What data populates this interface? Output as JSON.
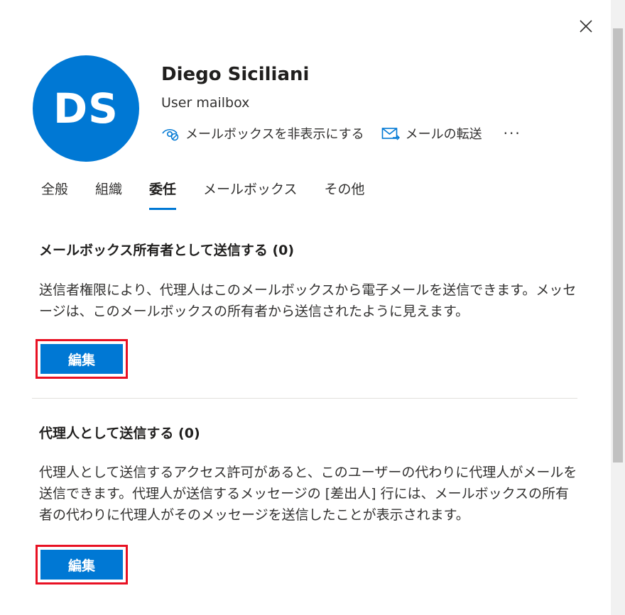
{
  "user": {
    "initials": "DS",
    "name": "Diego Siciliani",
    "type": "User mailbox"
  },
  "actions": {
    "hide_mailbox": "メールボックスを非表示にする",
    "forward_mail": "メールの転送",
    "more": "···"
  },
  "tabs": [
    "全般",
    "組織",
    "委任",
    "メールボックス",
    "その他"
  ],
  "active_tab": "委任",
  "sections": {
    "send_as": {
      "title": "メールボックス所有者として送信する (0)",
      "description": "送信者権限により、代理人はこのメールボックスから電子メールを送信できます。メッセージは、このメールボックスの所有者から送信されたように見えます。",
      "edit_label": "編集"
    },
    "send_on_behalf": {
      "title": "代理人として送信する (0)",
      "description": "代理人として送信するアクセス許可があると、このユーザーの代わりに代理人がメールを送信できます。代理人が送信するメッセージの [差出人] 行には、メールボックスの所有者の代わりに代理人がそのメッセージを送信したことが表示されます。",
      "edit_label": "編集"
    }
  },
  "colors": {
    "accent": "#0078d4",
    "highlight_border": "#e81123"
  }
}
